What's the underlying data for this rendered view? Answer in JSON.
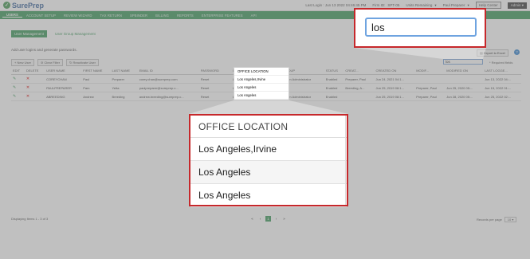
{
  "header": {
    "logo": "SurePrep",
    "last_login": "Last Login : Jun 13 2022 04:46:45 PM",
    "firm_id_label": "Firm ID:",
    "firm_id": "SPT-05",
    "units_remaining": "Units Remaining",
    "user_select": "Paul Preparer",
    "help_center": "Help Center",
    "admin": "Admin"
  },
  "nav": [
    "USERS",
    "ACCOUNT SETUP",
    "REVIEW WIZARD",
    "TAX RETURN",
    "SPBINDER",
    "BILLING",
    "REPORTS",
    "ENTERPRISE FEATURES",
    "API"
  ],
  "subtabs": [
    "User Management",
    "User Group Management"
  ],
  "hint": "Add user logins and generate passwords.",
  "toolbar": {
    "new_user": "New User",
    "clear_filter": "Clear Filter",
    "reactivate": "Reactivate User",
    "export": "Export to Excel",
    "required": "Required fields"
  },
  "search": {
    "value": "los"
  },
  "table": {
    "headers": [
      "EDIT",
      "DELETE",
      "USER NAME",
      "FIRST NAME",
      "LAST NAME",
      "EMAIL ID",
      "PASSWORD",
      "",
      "OFFICE LOCATION",
      "USER GROUP",
      "STATUS",
      "CREAT...",
      "CREATED ON",
      "MODIF...",
      "MODIFIED ON",
      "LAST LOGGE..."
    ],
    "rows": [
      [
        "",
        "",
        "COREYCHAN",
        "Paul",
        "Preparer",
        "corey.chan@sureprep.com",
        "Reset",
        "",
        "Los Angeles,Irvine",
        "Firm System Administrator",
        "Enabled",
        "Preparer, Paul",
        "Jun 24, 2021 04:1...",
        "",
        "",
        "Jun 13, 2022 04:..."
      ],
      [
        "",
        "",
        "PAULPREPARER",
        "Pam",
        "Yetta",
        "paulpreparer@sureprep.c...",
        "Reset",
        "",
        "Los Angeles",
        "Firm Staff",
        "Enabled",
        "Breeding, A...",
        "Jun 25, 2019 08:1...",
        "Preparer, Paul",
        "Jun 25, 2020 05:...",
        "Jun 15, 2022 01:..."
      ],
      [
        "",
        "",
        "ABREEDING",
        "Andrew",
        "Breeding",
        "andrew.breeding@sureprep.c...",
        "Reset",
        "",
        "Los Angeles",
        "Firm System Administrator",
        "Enabled",
        "",
        "Jun 25, 2019 08:1...",
        "Preparer, Paul",
        "Jun 28, 2020 05:...",
        "Jun 25, 2022 02:..."
      ]
    ]
  },
  "small_dropdown": {
    "header": "OFFICE LOCATION",
    "items": [
      "Los Angeles,Irvine",
      "Los Angeles",
      "Los Angeles"
    ]
  },
  "callout": {
    "header": "OFFICE LOCATION",
    "items": [
      "Los Angeles,Irvine",
      "Los Angeles",
      "Los Angeles"
    ]
  },
  "footer": {
    "items": "Displaying Items 1 - 3 of 3",
    "page": "1",
    "records_label": "Records per page",
    "records": "10"
  },
  "colors": {
    "brand_green": "#1f8a43",
    "callout_red": "#c6282b",
    "focus_blue": "#6fa4e0"
  }
}
